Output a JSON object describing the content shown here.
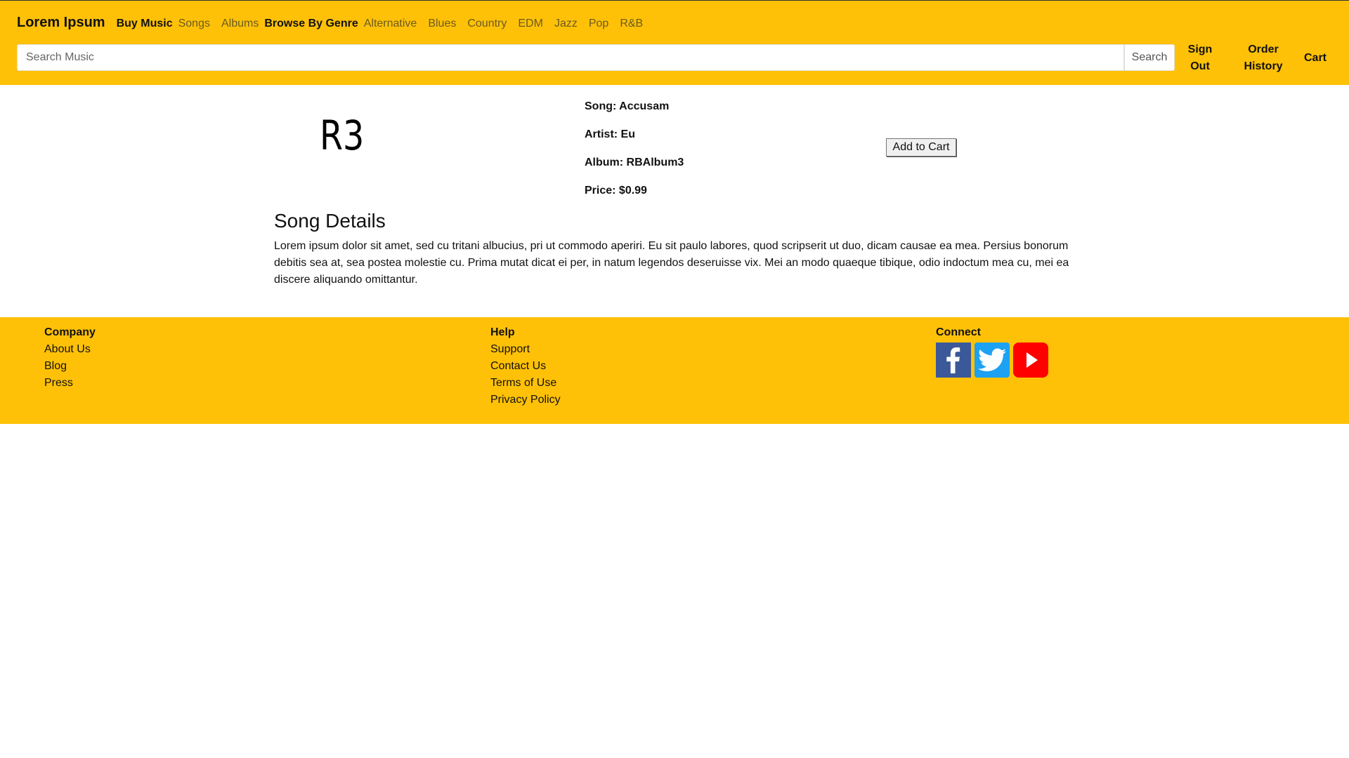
{
  "header": {
    "brand": "Lorem Ipsum",
    "buy_music": "Buy Music",
    "buy_links": [
      "Songs",
      "Albums"
    ],
    "browse_genre": "Browse By Genre",
    "genres": [
      "Alternative",
      "Blues",
      "Country",
      "EDM",
      "Jazz",
      "Pop",
      "R&B"
    ],
    "search_placeholder": "Search Music",
    "search_button": "Search",
    "sign_out": "Sign Out",
    "order_history": "Order History",
    "cart": "Cart"
  },
  "song": {
    "art_text": "R3",
    "song": "Song: Accusam",
    "artist": "Artist: Eu",
    "album": "Album: RBAlbum3",
    "price": "Price: $0.99",
    "add_to_cart": "Add to Cart",
    "details_title": "Song Details",
    "details_text": "Lorem ipsum dolor sit amet, sed cu tritani albucius, pri ut commodo aperiri. Eu sit paulo labores, quod scripserit ut duo, dicam causae ea mea. Persius bonorum debitis sea at, sea postea molestie cu. Prima mutat dicat ei per, in natum legendos deseruisse vix. Mei an modo quaeque tibique, odio indoctum mea cu, mei ea discere aliquando omittantur."
  },
  "footer": {
    "company": {
      "title": "Company",
      "links": [
        "About Us",
        "Blog",
        "Press"
      ]
    },
    "help": {
      "title": "Help",
      "links": [
        "Support",
        "Contact Us",
        "Terms of Use",
        "Privacy Policy"
      ]
    },
    "connect": {
      "title": "Connect",
      "icons": [
        "facebook-icon",
        "twitter-icon",
        "youtube-icon"
      ]
    }
  },
  "colors": {
    "brand_yellow": "#ffc107",
    "facebook": "#3b5998",
    "twitter": "#1da1f2",
    "youtube": "#ff0000"
  }
}
